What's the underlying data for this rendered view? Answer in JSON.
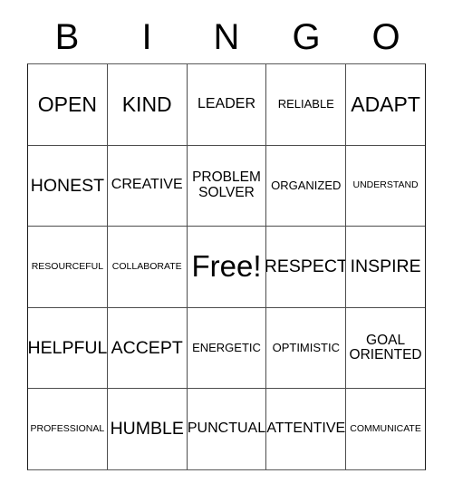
{
  "card": {
    "header_letters": [
      "B",
      "I",
      "N",
      "G",
      "O"
    ],
    "rows": [
      [
        {
          "text": "OPEN",
          "size": "xl"
        },
        {
          "text": "KIND",
          "size": "xl"
        },
        {
          "text": "LEADER",
          "size": "md"
        },
        {
          "text": "RELIABLE",
          "size": "sm"
        },
        {
          "text": "ADAPT",
          "size": "xl"
        }
      ],
      [
        {
          "text": "HONEST",
          "size": "lg"
        },
        {
          "text": "CREATIVE",
          "size": "md"
        },
        {
          "text": "PROBLEM\nSOLVER",
          "size": "2l"
        },
        {
          "text": "ORGANIZED",
          "size": "sm"
        },
        {
          "text": "UNDERSTAND",
          "size": "xs"
        }
      ],
      [
        {
          "text": "RESOURCEFUL",
          "size": "xs"
        },
        {
          "text": "COLLABORATE",
          "size": "xs"
        },
        {
          "text": "Free!",
          "size": "xxl"
        },
        {
          "text": "RESPECT",
          "size": "lg"
        },
        {
          "text": "INSPIRE",
          "size": "lg"
        }
      ],
      [
        {
          "text": "HELPFUL",
          "size": "lg"
        },
        {
          "text": "ACCEPT",
          "size": "lg"
        },
        {
          "text": "ENERGETIC",
          "size": "sm"
        },
        {
          "text": "OPTIMISTIC",
          "size": "sm"
        },
        {
          "text": "GOAL\nORIENTED",
          "size": "2l"
        }
      ],
      [
        {
          "text": "PROFESSIONAL",
          "size": "xs"
        },
        {
          "text": "HUMBLE",
          "size": "lg"
        },
        {
          "text": "PUNCTUAL",
          "size": "md"
        },
        {
          "text": "ATTENTIVE",
          "size": "md"
        },
        {
          "text": "COMMUNICATE",
          "size": "xs"
        }
      ]
    ]
  },
  "colors": {
    "background": "#ffffff",
    "text": "#000000",
    "grid_line": "#4d4d4d",
    "grid_border": "#1a1a1a"
  }
}
